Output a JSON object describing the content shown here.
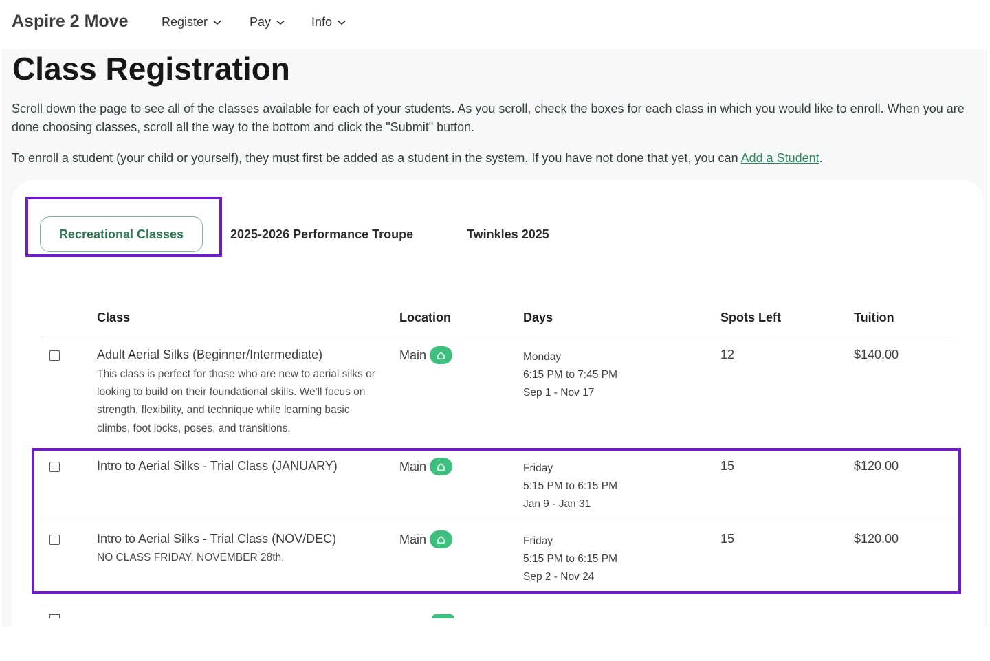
{
  "nav": {
    "brand": "Aspire 2 Move",
    "items": [
      {
        "label": "Register"
      },
      {
        "label": "Pay"
      },
      {
        "label": "Info"
      }
    ]
  },
  "page": {
    "title": "Class Registration",
    "intro": "Scroll down the page to see all of the classes available for each of your students. As you scroll, check the boxes for each class in which you would like to enroll. When you are done choosing classes, scroll all the way to the bottom and click the \"Submit\" button.",
    "enroll_text": "To enroll a student (your child or yourself), they must first be added as a student in the system. If you have not done that yet, you can",
    "add_student_link": "Add a Student",
    "enroll_end": "."
  },
  "tabs": [
    {
      "label": "Recreational Classes",
      "active": true
    },
    {
      "label": "2025-2026 Performance Troupe",
      "active": false
    },
    {
      "label": "Twinkles 2025",
      "active": false
    }
  ],
  "table": {
    "headers": {
      "class": "Class",
      "location": "Location",
      "days": "Days",
      "spots": "Spots Left",
      "tuition": "Tuition"
    },
    "rows": [
      {
        "title": "Adult Aerial Silks (Beginner/Intermediate)",
        "description": "This class is perfect for those who are new to aerial silks or looking to build on their foundational skills. We'll focus on strength, flexibility, and technique while learning basic climbs, foot locks, poses, and transitions.",
        "location": "Main",
        "day": "Monday",
        "time": "6:15 PM to 7:45 PM",
        "dates": "Sep 1 - Nov 17",
        "spots": "12",
        "tuition": "$140.00"
      },
      {
        "title": "Intro to Aerial Silks - Trial Class (JANUARY)",
        "description": "",
        "location": "Main",
        "day": "Friday",
        "time": "5:15 PM to 6:15 PM",
        "dates": "Jan 9 - Jan 31",
        "spots": "15",
        "tuition": "$120.00"
      },
      {
        "title": "Intro to Aerial Silks - Trial Class (NOV/DEC)",
        "description": "NO CLASS FRIDAY, NOVEMBER 28th.",
        "location": "Main",
        "day": "Friday",
        "time": "5:15 PM to 6:15 PM",
        "dates": "Sep 2 - Nov 24",
        "spots": "15",
        "tuition": "$120.00"
      }
    ]
  },
  "colors": {
    "accent_green": "#2f7a50",
    "badge_green": "#3fbf7f",
    "highlight_purple": "#6d1ec8"
  },
  "icons": {
    "nav_dropdown": "chevron-down-icon",
    "location_badge": "home-icon"
  }
}
